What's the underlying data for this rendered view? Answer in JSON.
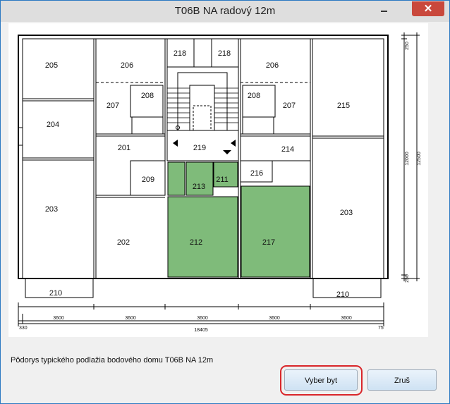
{
  "window": {
    "title": "T06B NA radový 12m",
    "close_icon": "✕",
    "minimize_icon": "minimize-icon"
  },
  "plan": {
    "rooms": {
      "r205": "205",
      "r206a": "206",
      "r218a": "218",
      "r218b": "218",
      "r206b": "206",
      "r208a": "208",
      "r207a": "207",
      "r208b": "208",
      "r207b": "207",
      "r215": "215",
      "r204": "204",
      "r201": "201",
      "r219": "219",
      "r214": "214",
      "r209": "209",
      "r213": "213",
      "r211": "211",
      "r216": "216",
      "r203a": "203",
      "r203b": "203",
      "r202": "202",
      "r212": "212",
      "r217": "217",
      "r210a": "210",
      "r210b": "210"
    },
    "highlight_color": "#7fbb7a",
    "dims": {
      "d1": "3600",
      "d2": "3600",
      "d3": "3600",
      "d4": "3600",
      "d5": "3600",
      "left": "330",
      "total": "18405",
      "right": "75",
      "v_top": "250",
      "v_bottom": "250",
      "v_inner": "12000",
      "v_outer": "12500"
    }
  },
  "description": "Pôdorys typického podlažia bodového domu T06B NA 12m",
  "buttons": {
    "select": "Vyber byt",
    "cancel": "Zruš"
  }
}
